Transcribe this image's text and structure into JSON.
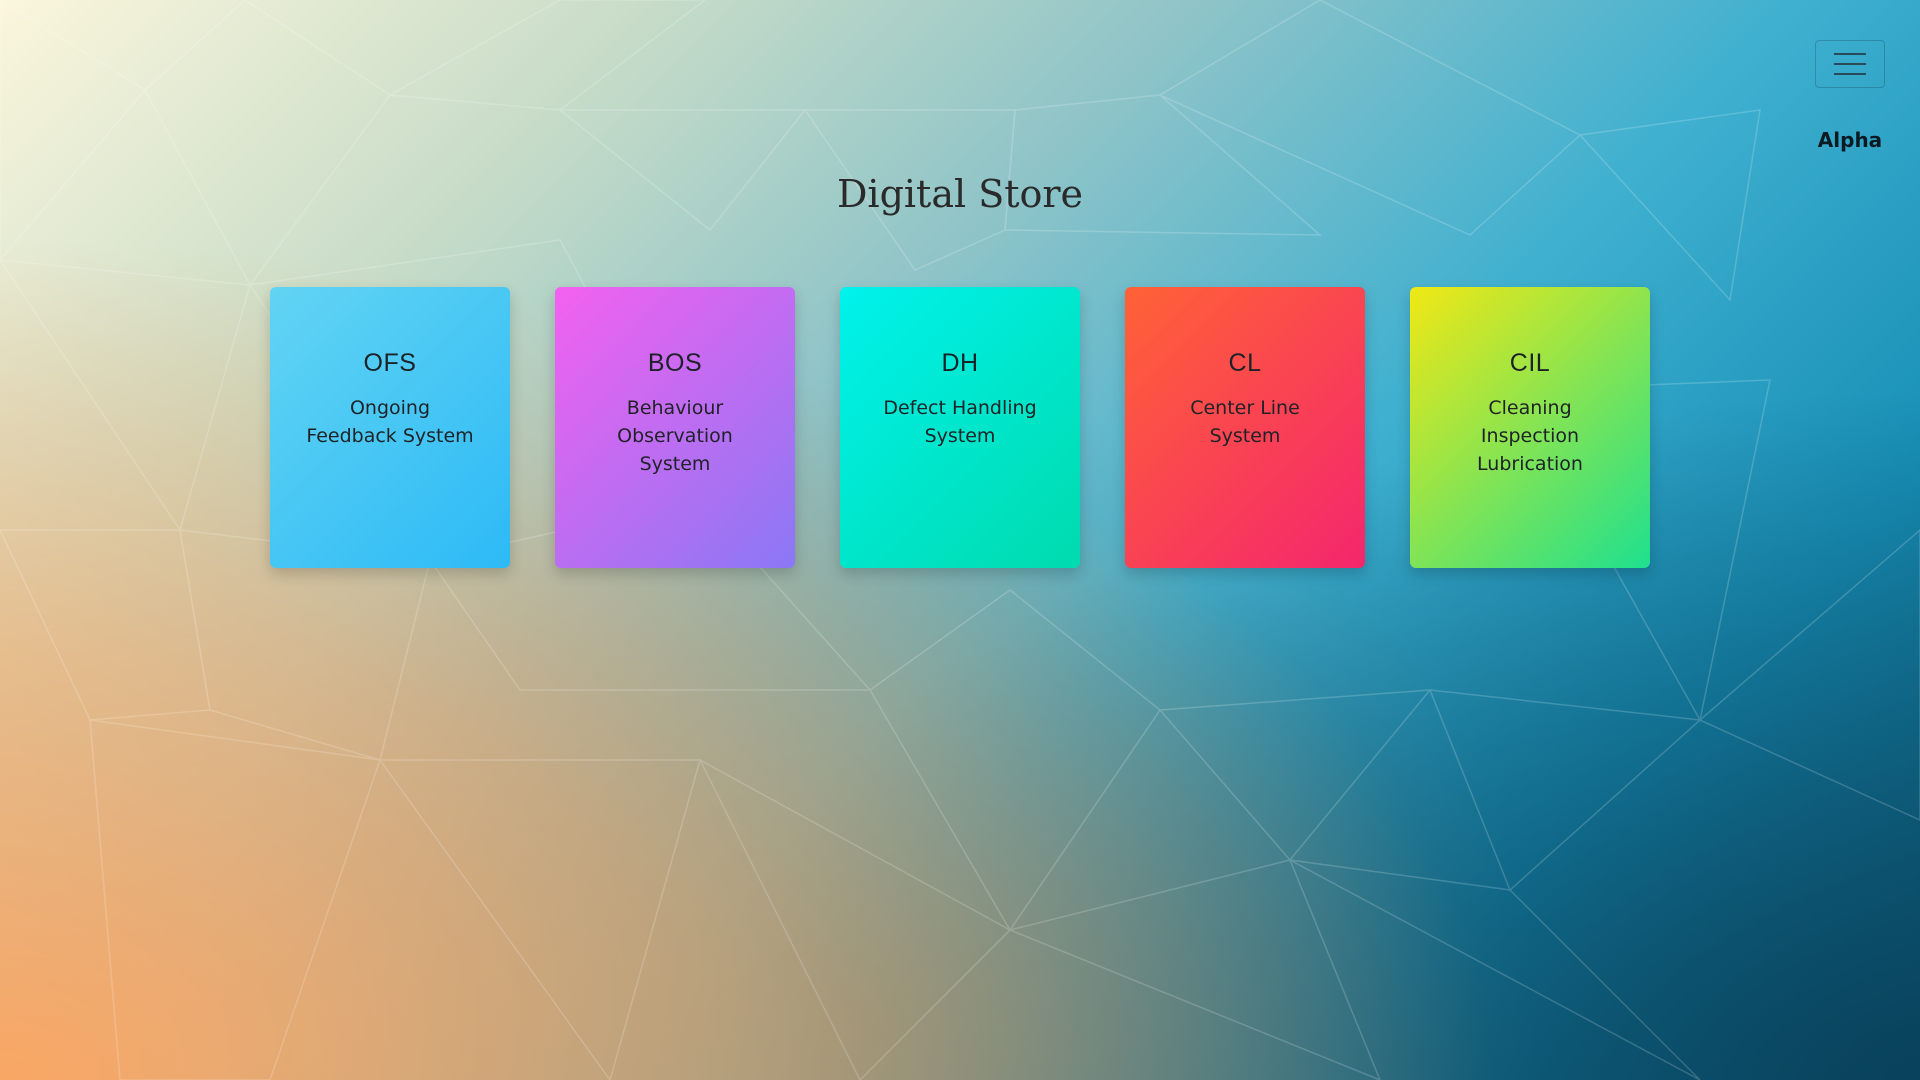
{
  "header": {
    "menu_icon": "hamburger-menu-icon",
    "version_label": "Alpha"
  },
  "main": {
    "title": "Digital Store",
    "cards": [
      {
        "code": "OFS",
        "description": "Ongoing Feedback System",
        "gradient": [
          "#62d4f3",
          "#2dbaf6"
        ]
      },
      {
        "code": "BOS",
        "description": "Behaviour Observation System",
        "gradient": [
          "#f361ef",
          "#8a78f4"
        ]
      },
      {
        "code": "DH",
        "description": "Defect Handling System",
        "gradient": [
          "#00f2ec",
          "#00dbae"
        ]
      },
      {
        "code": "CL",
        "description": "Center Line System",
        "gradient": [
          "#ff6236",
          "#f4266d"
        ]
      },
      {
        "code": "CIL",
        "description": "Cleaning Inspection Lubrication",
        "gradient": [
          "#f1e814",
          "#1ee08f"
        ]
      }
    ]
  },
  "colors": {
    "background_start": "#fbf6dc",
    "background_end": "#0d5f7e",
    "text_dark": "#1c2228"
  }
}
